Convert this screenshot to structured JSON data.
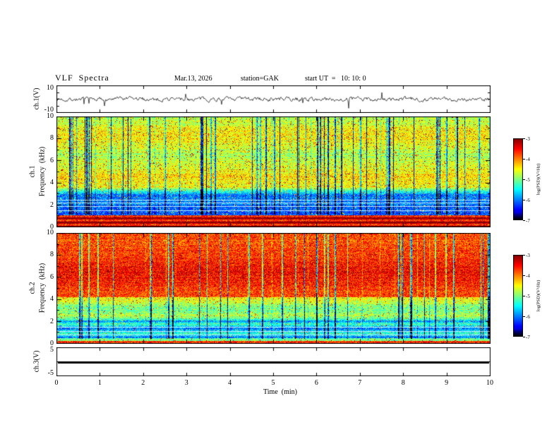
{
  "header": {
    "title": "VLF  Spectra",
    "date": "Mar.13, 2026",
    "station": "station=GAK",
    "start_ut": "start UT  =   10: 10: 0"
  },
  "xaxis": {
    "label": "Time  (min)",
    "ticks": [
      "0",
      "1",
      "2",
      "3",
      "4",
      "5",
      "6",
      "7",
      "8",
      "9",
      "10"
    ],
    "range": [
      0,
      10
    ]
  },
  "panels": {
    "ch1_wave": {
      "ylabel": "ch.1(V)",
      "ytick_labels": [
        "10",
        "-10"
      ],
      "ytick_values": [
        10,
        -10
      ],
      "ylim": [
        -10,
        10
      ]
    },
    "ch1_spec": {
      "ylabel_channel": "ch.1",
      "ylabel_axis": "Frequency  (kHz)",
      "ytick_labels": [
        "10",
        "8",
        "6",
        "4",
        "2",
        "0"
      ],
      "ytick_values": [
        10,
        8,
        6,
        4,
        2,
        0
      ],
      "ylim": [
        0,
        10
      ]
    },
    "ch2_spec": {
      "ylabel_channel": "ch.2",
      "ylabel_axis": "Frequency  (kHz)",
      "ytick_labels": [
        "10",
        "8",
        "6",
        "4",
        "2",
        "0"
      ],
      "ytick_values": [
        10,
        8,
        6,
        4,
        2,
        0
      ],
      "ylim": [
        0,
        10
      ]
    },
    "ch3_wave": {
      "ylabel": "ch.3(V)",
      "ytick_labels": [
        "5",
        "-5"
      ],
      "ytick_values": [
        5,
        -5
      ],
      "ylim": [
        -5,
        5
      ]
    }
  },
  "colorbar": {
    "label": "log(PSD)(V²/Hz)",
    "tick_labels": [
      "-3",
      "-4",
      "-5",
      "-6",
      "-7"
    ],
    "tick_values": [
      -3,
      -4,
      -5,
      -6,
      -7
    ],
    "range": [
      -7,
      -3
    ],
    "colormap_jet": [
      "#000000",
      "#00007f",
      "#0000ff",
      "#00ffff",
      "#00ff00",
      "#ffff00",
      "#ff0000",
      "#7f0000"
    ]
  },
  "chart_data": [
    {
      "type": "line",
      "title": "ch.1 voltage time series",
      "xlabel": "Time (min)",
      "ylabel": "ch.1(V)",
      "xlim": [
        0,
        10
      ],
      "ylim": [
        -10,
        10
      ],
      "yticks": [
        10,
        -10
      ],
      "summary": "Continuous broadband noise trace oscillating about 0 V with typical amplitude ±2 V and intermittent sharp negative spikes reaching approximately -8 V throughout the 10-minute record."
    },
    {
      "type": "heatmap",
      "title": "ch.1 VLF spectrogram",
      "xlabel": "Time (min)",
      "ylabel": "Frequency (kHz)",
      "zlabel": "log(PSD)(V²/Hz)",
      "xlim": [
        0,
        10
      ],
      "ylim": [
        0,
        10
      ],
      "zlim": [
        -7,
        -3
      ],
      "colormap": "jet",
      "bands": [
        {
          "freq_khz": [
            0,
            1.1
          ],
          "mean_level": -3.4,
          "appearance": "intense red/orange/yellow horizontal striations (power-line hum harmonics)"
        },
        {
          "freq_khz": [
            1.1,
            3
          ],
          "mean_level": -6.1,
          "appearance": "low-power blue background with thin bright horizontal lines near 2-2.5 kHz"
        },
        {
          "freq_khz": [
            3,
            10
          ],
          "mean_level": -4.6,
          "appearance": "diffuse green-yellow power with red speckles and frequent dark-blue vertical dropout streaks (impulses/sferics)"
        }
      ]
    },
    {
      "type": "heatmap",
      "title": "ch.2 VLF spectrogram",
      "xlabel": "Time (min)",
      "ylabel": "Frequency (kHz)",
      "zlabel": "log(PSD)(V²/Hz)",
      "xlim": [
        0,
        10
      ],
      "ylim": [
        0,
        10
      ],
      "zlim": [
        -7,
        -3
      ],
      "colormap": "jet",
      "bands": [
        {
          "freq_khz": [
            0,
            0.3
          ],
          "mean_level": -3.7,
          "appearance": "narrow red/orange band at lowest frequencies"
        },
        {
          "freq_khz": [
            0.3,
            2.2
          ],
          "mean_level": -5.6,
          "appearance": "blue/cyan background with thin bright horizontal lines near 1-1.5 kHz"
        },
        {
          "freq_khz": [
            2.2,
            4.2
          ],
          "mean_level": -4.9,
          "appearance": "green/cyan band"
        },
        {
          "freq_khz": [
            4.2,
            10
          ],
          "mean_level": -3.7,
          "appearance": "saturated red/orange power with yellow patches and sparse dark vertical streaks"
        }
      ]
    },
    {
      "type": "line",
      "title": "ch.3 voltage time series",
      "xlabel": "Time (min)",
      "ylabel": "ch.3(V)",
      "xlim": [
        0,
        10
      ],
      "ylim": [
        -5,
        5
      ],
      "yticks": [
        5,
        -5
      ],
      "values_constant": 0,
      "summary": "Flat thick line at 0 V for the entire interval (no signal)."
    }
  ]
}
